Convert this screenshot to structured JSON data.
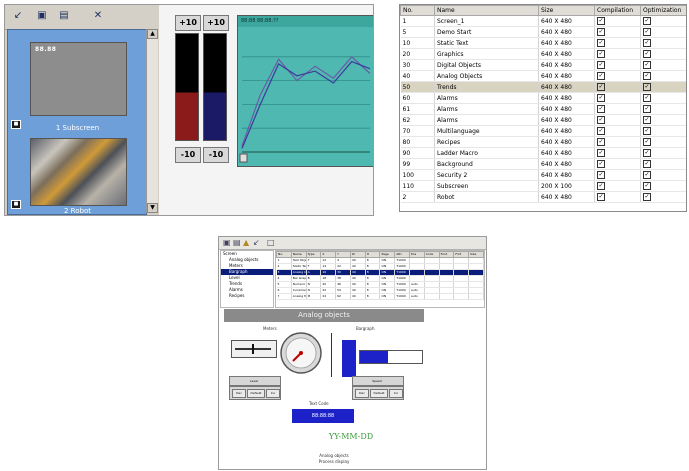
{
  "panel_a": {
    "toolbar_icons": [
      "pin-icon",
      "window-icon",
      "window-split-icon",
      "close-icon"
    ],
    "subscreen1": {
      "mini_label": "88.88",
      "caption": "1 Subscreen"
    },
    "subscreen2": {
      "caption": "2 Robot"
    },
    "bars": {
      "left_top": "+10",
      "right_top": "+10",
      "left_bottom": "-10",
      "right_bottom": "-10",
      "left_level": 0.45,
      "right_level": 0.45,
      "colors": {
        "left_fill": "#8b1a1a",
        "right_fill": "#1a1a66",
        "empty": "#000000"
      }
    },
    "trend": {
      "header": "88:88 88:88:??",
      "bg_color": "#4fb8b0",
      "series": [
        {
          "values": [
            5,
            48,
            78,
            60,
            72,
            62,
            80,
            66
          ],
          "color": "#6b5aa8"
        },
        {
          "values": [
            3,
            40,
            74,
            64,
            68,
            58,
            76,
            70
          ],
          "color": "#3b3b9c"
        }
      ],
      "ylim": [
        0,
        100
      ]
    }
  },
  "panel_b": {
    "columns": [
      "No.",
      "Name",
      "Size",
      "Compilation",
      "Optimization"
    ],
    "rows": [
      {
        "no": "1",
        "name": "Screen_1",
        "size": "640 X 480"
      },
      {
        "no": "5",
        "name": "Demo Start",
        "size": "640 X 480"
      },
      {
        "no": "10",
        "name": "Static Text",
        "size": "640 X 480"
      },
      {
        "no": "20",
        "name": "Graphics",
        "size": "640 X 480"
      },
      {
        "no": "30",
        "name": "Digital Objects",
        "size": "640 X 480"
      },
      {
        "no": "40",
        "name": "Analog Objects",
        "size": "640 X 480"
      },
      {
        "no": "50",
        "name": "Trends",
        "size": "640 X 480",
        "selected": true
      },
      {
        "no": "60",
        "name": "Alarms",
        "size": "640 X 480"
      },
      {
        "no": "61",
        "name": "Alarms",
        "size": "640 X 480"
      },
      {
        "no": "62",
        "name": "Alarms",
        "size": "640 X 480"
      },
      {
        "no": "70",
        "name": "Multilanguage",
        "size": "640 X 480"
      },
      {
        "no": "80",
        "name": "Recipes",
        "size": "640 X 480"
      },
      {
        "no": "90",
        "name": "Ladder Macro",
        "size": "640 X 480"
      },
      {
        "no": "99",
        "name": "Background",
        "size": "640 X 480"
      },
      {
        "no": "100",
        "name": "Security 2",
        "size": "640 X 480"
      },
      {
        "no": "110",
        "name": "Subscreen",
        "size": "200 X 100"
      },
      {
        "no": "2",
        "name": "Robot",
        "size": "640 X 480"
      }
    ],
    "check_glyph": "✓"
  },
  "panel_c": {
    "banner": "Analog objects",
    "label_meters": "Meters",
    "label_bargraph": "Bargraph",
    "label_textcode": "Text Code",
    "field_value": "88:88:88",
    "date_format": "YY-MM-DD",
    "footer_line1": "Analog objects",
    "footer_line2": "Process display",
    "tree_items": [
      "Screen",
      "Analog objects",
      "Meters",
      "Bargraph",
      "Level",
      "Trends",
      "Alarms",
      "Recipes"
    ],
    "grid_columns": [
      "No.",
      "Name",
      "Type",
      "X",
      "Y",
      "W",
      "H",
      "Page",
      "Attr",
      "Pos",
      "Color",
      "Font",
      "Fmt",
      "Size"
    ],
    "grid_rows": [
      [
        "1",
        "Text Object",
        "T",
        "12",
        "4",
        "40",
        "8",
        "ON",
        "T1000",
        "",
        "",
        "",
        "",
        ""
      ],
      [
        "2",
        "Static Text",
        "T",
        "14",
        "22",
        "40",
        "8",
        "ON",
        "T1000",
        "",
        "",
        "",
        "",
        ""
      ],
      [
        "3",
        "Analog Object",
        "A",
        "16",
        "30",
        "40",
        "8",
        "ON",
        "T1000",
        "",
        "",
        "",
        "",
        ""
      ],
      [
        "4",
        "Bar Graph",
        "B",
        "18",
        "38",
        "40",
        "8",
        "ON",
        "T1000",
        "",
        "",
        "",
        "",
        ""
      ],
      [
        "5",
        "Numeric Field",
        "N",
        "20",
        "46",
        "40",
        "8",
        "ON",
        "T1000",
        "auto",
        "",
        "",
        "",
        ""
      ],
      [
        "6",
        "Incremental Field",
        "N",
        "22",
        "54",
        "40",
        "8",
        "ON",
        "T1000",
        "auto",
        "",
        "",
        "",
        ""
      ],
      [
        "7",
        "Analog Meter",
        "M",
        "24",
        "62",
        "40",
        "8",
        "ON",
        "T1000",
        "auto",
        "",
        "",
        "",
        ""
      ]
    ],
    "bar_values": {
      "vertical": 0.85,
      "horizontal": 0.45
    },
    "button_groups": [
      {
        "title": "Level",
        "buttons": [
          "Dec",
          "Default",
          "Inc"
        ]
      },
      {
        "title": "Speed",
        "buttons": [
          "Dec",
          "Default",
          "Inc"
        ]
      }
    ]
  }
}
